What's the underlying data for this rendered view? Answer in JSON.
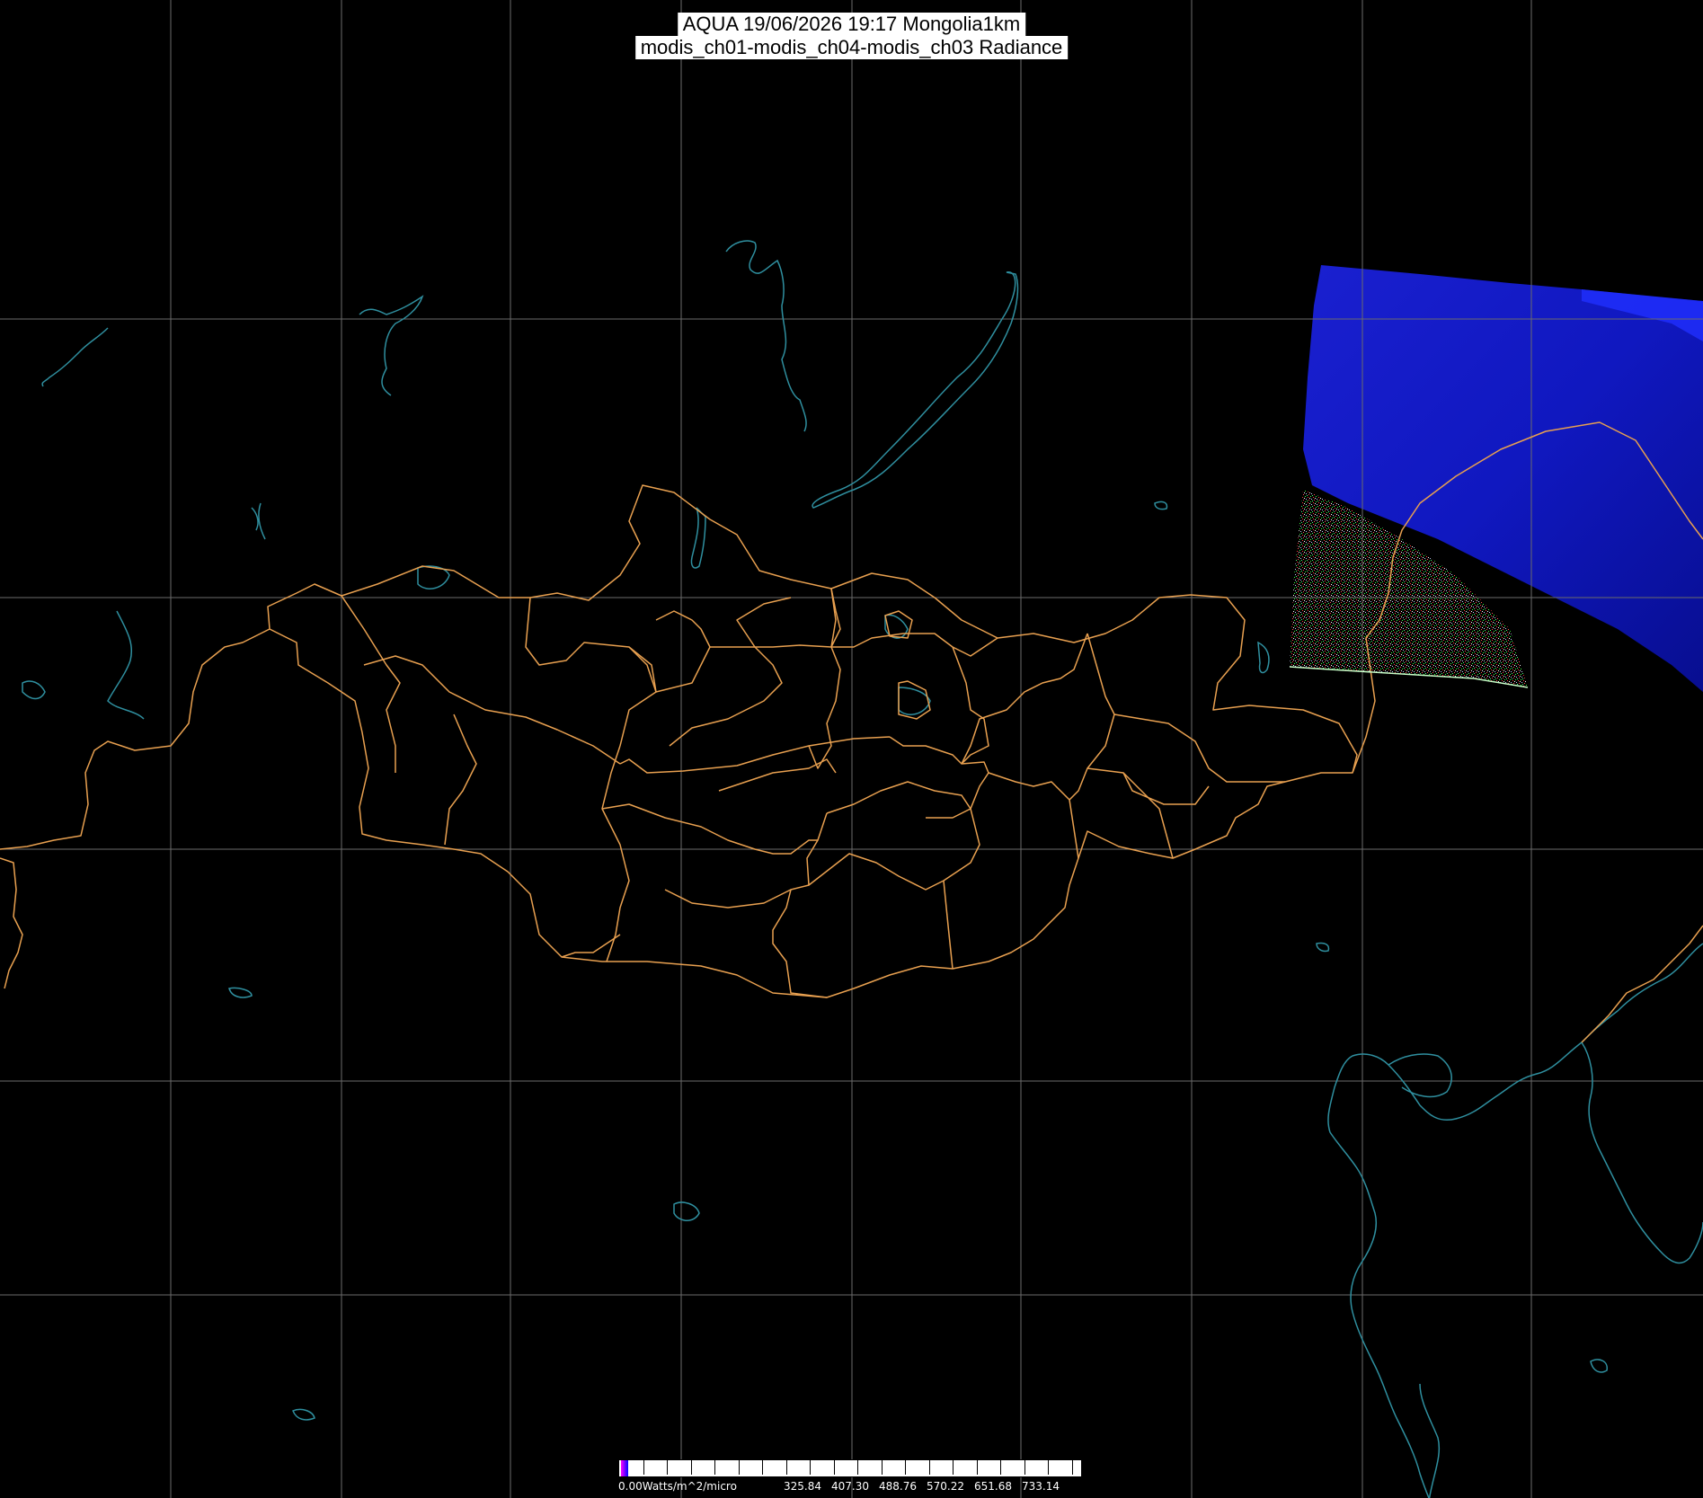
{
  "title": {
    "line1": "AQUA 19/06/2026 19:17 Mongolia1km",
    "line2": "modis_ch01-modis_ch04-modis_ch03 Radiance"
  },
  "colorbar": {
    "min_label": "0.00Watts/m^2/micro",
    "tick_labels": [
      "325.84",
      "407.30",
      "488.76",
      "570.22",
      "651.68",
      "733.14"
    ],
    "gradient_colors": [
      "#ff00ff",
      "#0000ff"
    ]
  },
  "colors": {
    "background": "#000000",
    "graticule": "#6b6b6b",
    "borders": "#e8a050",
    "coast_water": "#2f8f9f",
    "swath": "#1a1aff"
  }
}
